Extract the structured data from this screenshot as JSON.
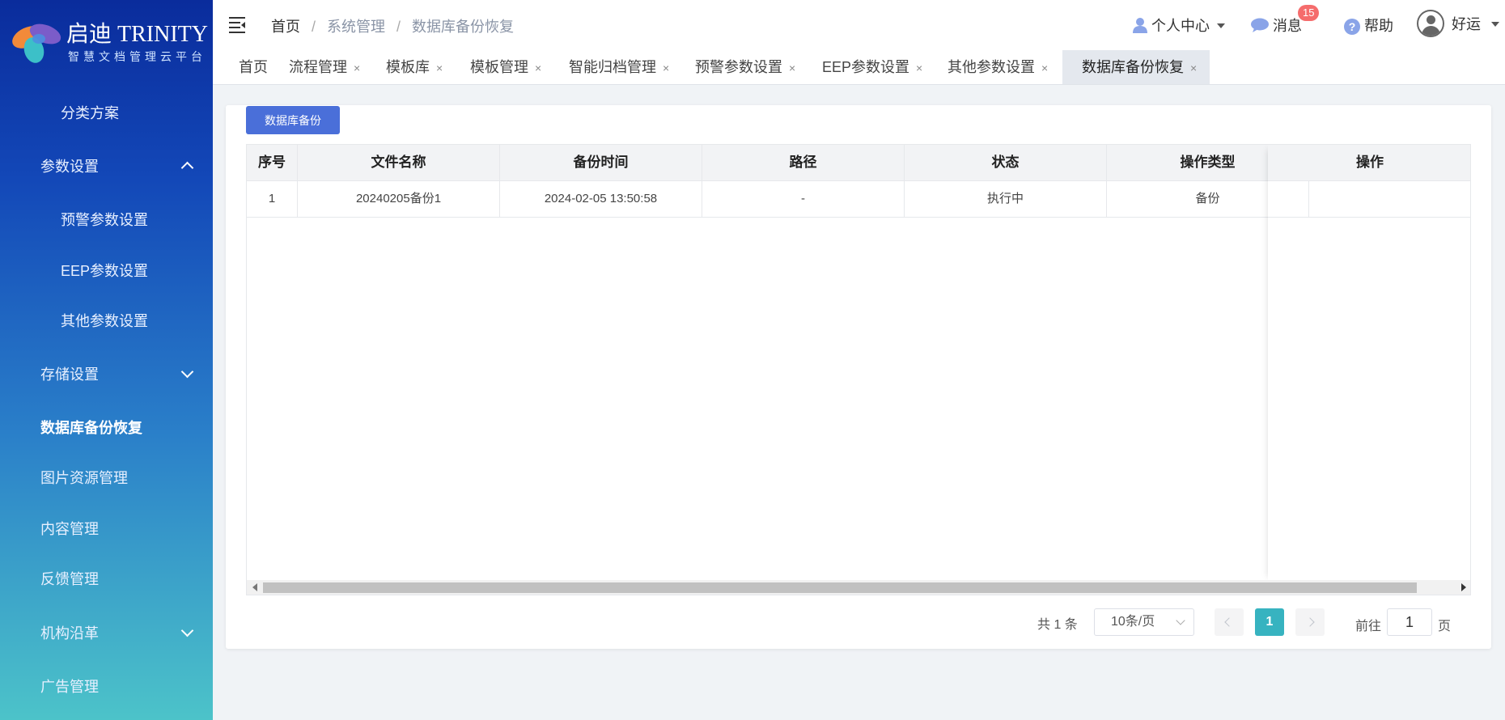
{
  "brand": {
    "title": "启迪 TRINITY",
    "subtitle": "智慧文档管理云平台"
  },
  "sidebar": {
    "items": [
      {
        "label": "分类方案",
        "level": 2
      },
      {
        "label": "参数设置",
        "level": 1,
        "chevron": "up"
      },
      {
        "label": "预警参数设置",
        "level": 2
      },
      {
        "label": "EEP参数设置",
        "level": 2
      },
      {
        "label": "其他参数设置",
        "level": 2
      },
      {
        "label": "存储设置",
        "level": 1,
        "chevron": "down"
      },
      {
        "label": "数据库备份恢复",
        "level": 1,
        "active": true
      },
      {
        "label": "图片资源管理",
        "level": 1
      },
      {
        "label": "内容管理",
        "level": 1
      },
      {
        "label": "反馈管理",
        "level": 1
      },
      {
        "label": "机构沿革",
        "level": 1,
        "chevron": "down"
      },
      {
        "label": "广告管理",
        "level": 1
      }
    ]
  },
  "header": {
    "breadcrumb": [
      "首页",
      "系统管理",
      "数据库备份恢复"
    ],
    "user_center": "个人中心",
    "messages": "消息",
    "message_count": "15",
    "help": "帮助",
    "username": "好运"
  },
  "tabs": [
    {
      "label": "首页",
      "closable": false
    },
    {
      "label": "流程管理",
      "closable": true
    },
    {
      "label": "模板库",
      "closable": true
    },
    {
      "label": "模板管理",
      "closable": true
    },
    {
      "label": "智能归档管理",
      "closable": true
    },
    {
      "label": "预警参数设置",
      "closable": true
    },
    {
      "label": "EEP参数设置",
      "closable": true
    },
    {
      "label": "其他参数设置",
      "closable": true
    },
    {
      "label": "数据库备份恢复",
      "closable": true,
      "active": true
    }
  ],
  "close_glyph": "×",
  "toolbar": {
    "backup_button": "数据库备份"
  },
  "table": {
    "columns": [
      "序号",
      "文件名称",
      "备份时间",
      "路径",
      "状态",
      "操作类型",
      "操作"
    ],
    "rows": [
      [
        "1",
        "20240205备份1",
        "2024-02-05 13:50:58",
        "-",
        "执行中",
        "备份",
        ""
      ]
    ]
  },
  "pagination": {
    "total_text": "共 1 条",
    "page_size": "10条/页",
    "current_page": "1",
    "goto_label": "前往",
    "goto_value": "1",
    "page_suffix": "页"
  },
  "colors": {
    "accent": "#4a6fd9",
    "page_active": "#37b3c0",
    "badge": "#f56c6c"
  }
}
